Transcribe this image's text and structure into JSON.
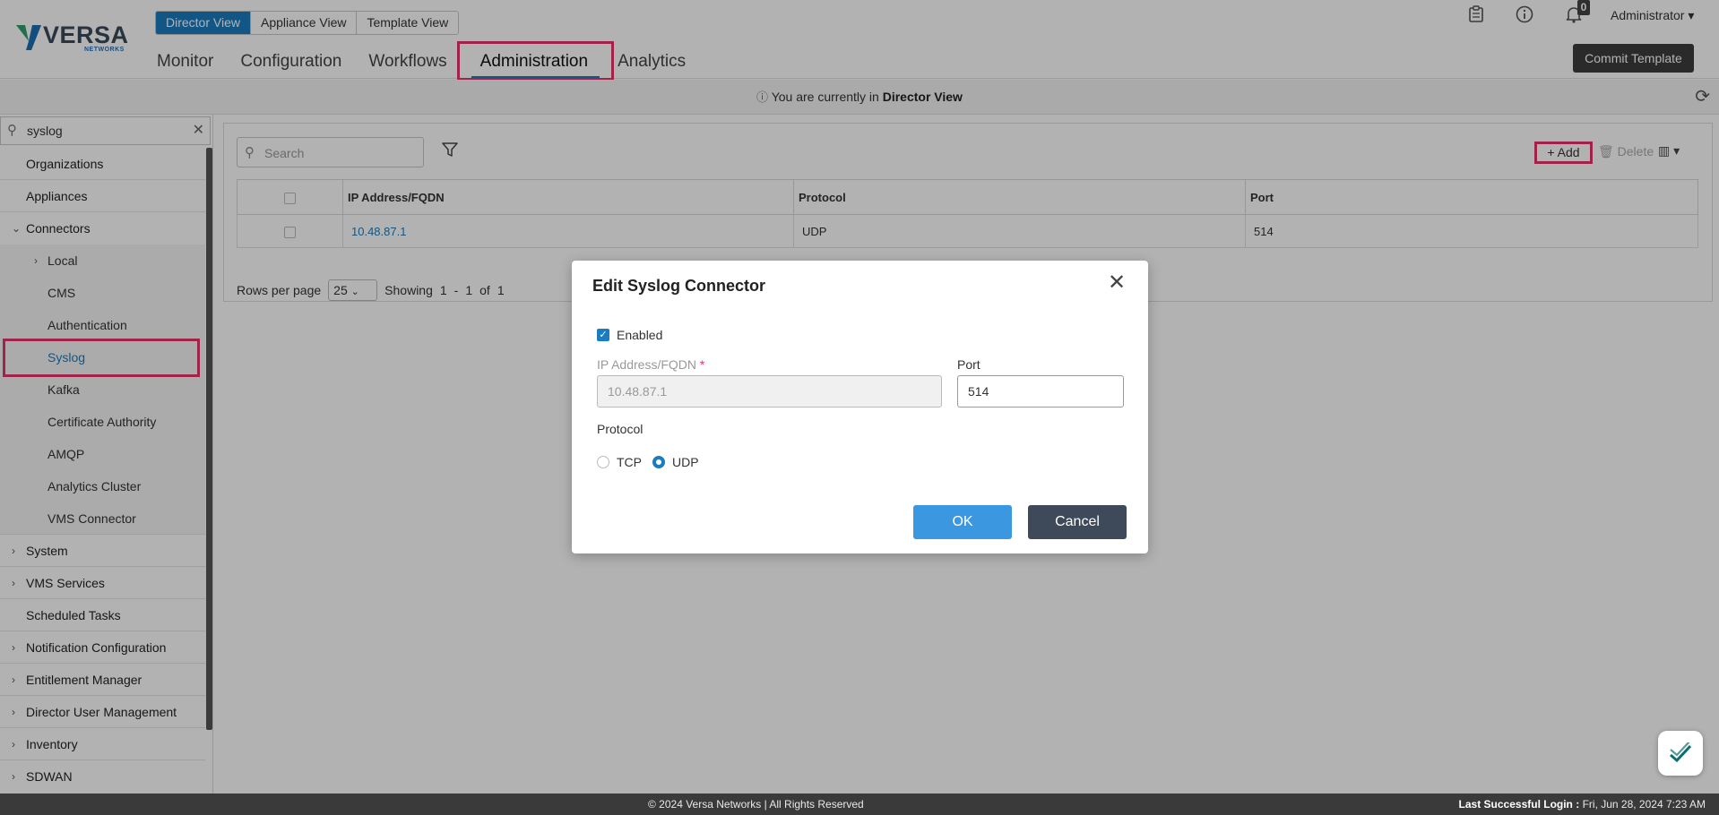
{
  "app": {
    "logo_text": "VERSA",
    "logo_sub": "NETWORKS",
    "view_tabs": [
      "Director View",
      "Appliance View",
      "Template View"
    ],
    "active_view": "Director View",
    "nav": [
      "Monitor",
      "Configuration",
      "Workflows",
      "Administration",
      "Analytics"
    ],
    "active_nav": "Administration",
    "notification_count": "0",
    "user_menu": "Administrator ▾",
    "commit_button": "Commit Template",
    "icons": {
      "tasks": "clipboard-icon",
      "info": "info-icon",
      "notifications": "bell-icon",
      "refresh": "refresh-icon"
    }
  },
  "infobar": {
    "prefix": "You are currently in",
    "view": "Director View"
  },
  "sidebar": {
    "search_value": "syslog",
    "items": [
      {
        "label": "Organizations",
        "chevron": ""
      },
      {
        "label": "Appliances",
        "chevron": ""
      },
      {
        "label": "Connectors",
        "chevron": "⌄"
      }
    ],
    "sub_items": [
      {
        "label": "Local",
        "chevron": "›"
      },
      {
        "label": "CMS",
        "chevron": ""
      },
      {
        "label": "Authentication",
        "chevron": ""
      },
      {
        "label": "Syslog",
        "chevron": ""
      },
      {
        "label": "Kafka",
        "chevron": ""
      },
      {
        "label": "Certificate Authority",
        "chevron": ""
      },
      {
        "label": "AMQP",
        "chevron": ""
      },
      {
        "label": "Analytics Cluster",
        "chevron": ""
      },
      {
        "label": "VMS Connector",
        "chevron": ""
      }
    ],
    "selected": "Syslog",
    "items_after": [
      {
        "label": "System",
        "chevron": "›"
      },
      {
        "label": "VMS Services",
        "chevron": "›"
      },
      {
        "label": "Scheduled Tasks",
        "chevron": ""
      },
      {
        "label": "Notification Configuration",
        "chevron": "›"
      },
      {
        "label": "Entitlement Manager",
        "chevron": "›"
      },
      {
        "label": "Director User Management",
        "chevron": "›"
      },
      {
        "label": "Inventory",
        "chevron": "›"
      },
      {
        "label": "SDWAN",
        "chevron": "›"
      }
    ]
  },
  "table": {
    "search_placeholder": "Search",
    "add_label": "+ Add",
    "delete_label": "🗑 Delete",
    "columns_label": "▥ ▾",
    "headers": [
      "IP Address/FQDN",
      "Protocol",
      "Port"
    ],
    "rows": [
      {
        "ip": "10.48.87.1",
        "protocol": "UDP",
        "port": "514"
      }
    ],
    "rows_per_page_label": "Rows per page",
    "rows_per_page": "25",
    "showing": "Showing",
    "range_start": "1",
    "range_sep": "-",
    "range_end": "1",
    "of": "of",
    "total": "1"
  },
  "modal": {
    "title": "Edit Syslog Connector",
    "enabled_label": "Enabled",
    "enabled": true,
    "ip_label": "IP Address/FQDN",
    "ip_value": "10.48.87.1",
    "port_label": "Port",
    "port_value": "514",
    "protocol_label": "Protocol",
    "protocol_options": [
      "TCP",
      "UDP"
    ],
    "protocol_selected": "UDP",
    "ok": "OK",
    "cancel": "Cancel"
  },
  "footer": {
    "copyright": "© 2024 Versa Networks | All Rights Reserved",
    "login_label": "Last Successful Login :",
    "login_value": "Fri, Jun 28, 2024 7:23 AM"
  },
  "colors": {
    "accent": "#1a7cc1",
    "highlight": "#e8336b",
    "ok_button": "#3a97e0",
    "cancel_button": "#3e4a5a"
  }
}
